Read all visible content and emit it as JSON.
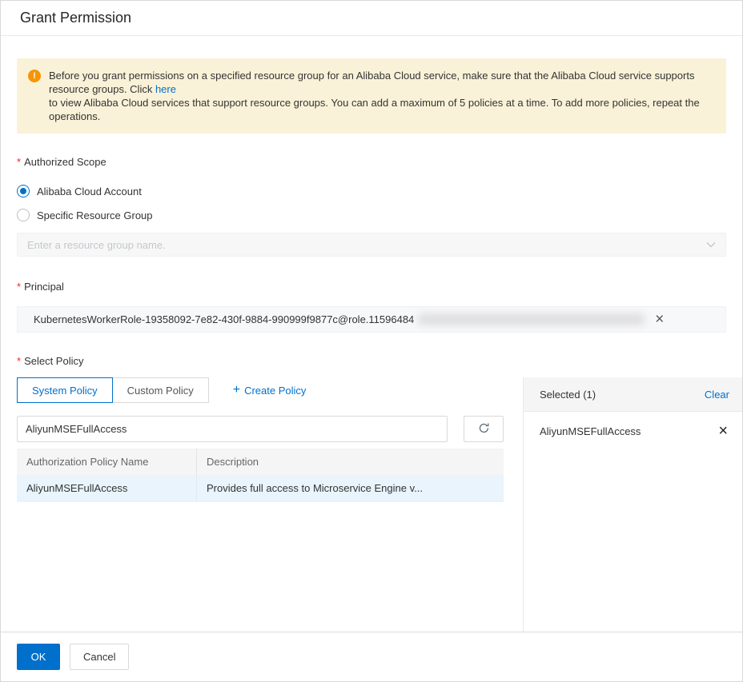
{
  "dialog": {
    "title": "Grant Permission"
  },
  "notice": {
    "text_before_link": "Before you grant permissions on a specified resource group for an Alibaba Cloud service, make sure that the Alibaba Cloud service supports resource groups. Click ",
    "link_text": "here",
    "text_after_link": "to view Alibaba Cloud services that support resource groups. You can add a maximum of 5 policies at a time. To add more policies, repeat the operations."
  },
  "authorized_scope": {
    "label": "Authorized Scope",
    "options": [
      {
        "label": "Alibaba Cloud Account",
        "selected": true
      },
      {
        "label": "Specific Resource Group",
        "selected": false
      }
    ],
    "resource_group_placeholder": "Enter a resource group name."
  },
  "principal": {
    "label": "Principal",
    "value": "KubernetesWorkerRole-19358092-7e82-430f-9884-990999f9877c@role.11596484"
  },
  "select_policy": {
    "label": "Select Policy",
    "tabs": [
      {
        "label": "System Policy",
        "active": true
      },
      {
        "label": "Custom Policy",
        "active": false
      }
    ],
    "create_policy_label": "Create Policy",
    "search_value": "AliyunMSEFullAccess",
    "table": {
      "columns": [
        "Authorization Policy Name",
        "Description"
      ],
      "rows": [
        {
          "name": "AliyunMSEFullAccess",
          "description": "Provides full access to Microservice Engine v..."
        }
      ]
    }
  },
  "selected_panel": {
    "title": "Selected (1)",
    "clear_label": "Clear",
    "items": [
      "AliyunMSEFullAccess"
    ]
  },
  "footer": {
    "ok_label": "OK",
    "cancel_label": "Cancel"
  },
  "icons": {
    "warning_mark": "!",
    "plus": "+",
    "close": "×",
    "chevron_down": "⌄"
  },
  "colors": {
    "accent": "#0070cc",
    "warning_bg": "#faf2d8",
    "warning_icon": "#f89406",
    "selected_row_bg": "#e9f4fc",
    "required_asterisk": "#f5222d"
  }
}
